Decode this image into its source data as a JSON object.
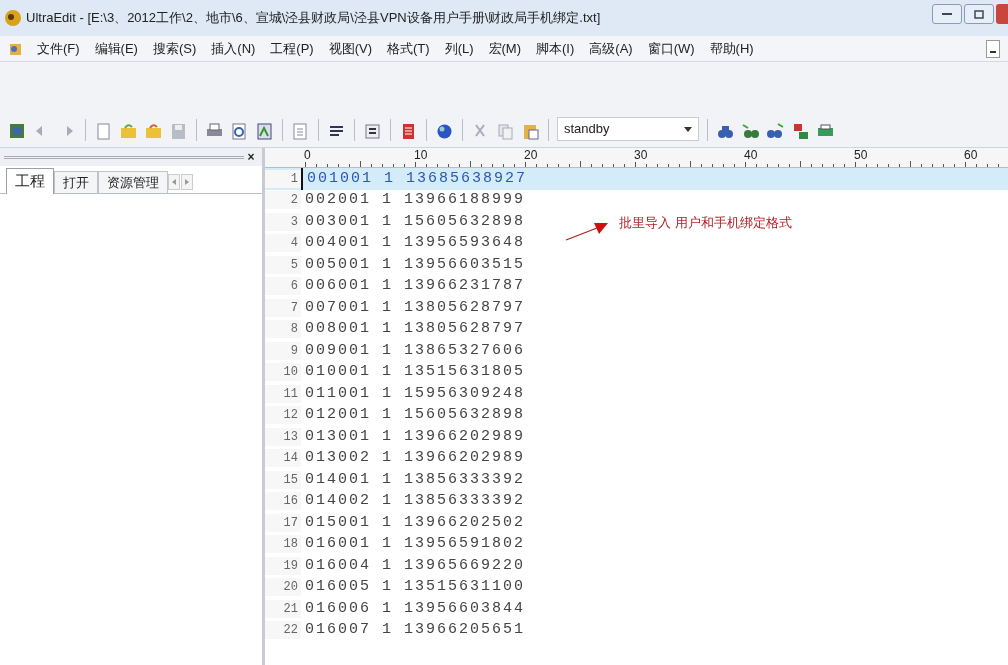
{
  "window": {
    "title": "UltraEdit - [E:\\3、2012工作\\2、地市\\6、宣城\\泾县财政局\\泾县VPN设备用户手册\\财政局手机绑定.txt]"
  },
  "menu": [
    "文件(F)",
    "编辑(E)",
    "搜索(S)",
    "插入(N)",
    "工程(P)",
    "视图(V)",
    "格式(T)",
    "列(L)",
    "宏(M)",
    "脚本(I)",
    "高级(A)",
    "窗口(W)",
    "帮助(H)"
  ],
  "toolbar": {
    "dropdown_value": "standby"
  },
  "side_panel": {
    "close_glyph": "×",
    "tabs": [
      {
        "label": "工程",
        "selected": true
      },
      {
        "label": "打开",
        "selected": false
      },
      {
        "label": "资源管理",
        "selected": false
      }
    ]
  },
  "editor": {
    "ruler_labels": [
      "0",
      "10",
      "20",
      "30",
      "40",
      "50",
      "60"
    ],
    "lines": [
      {
        "number": "1",
        "text": "001001 1 13685638927",
        "selected": true
      },
      {
        "number": "2",
        "text": "002001 1 13966188999",
        "selected": false
      },
      {
        "number": "3",
        "text": "003001 1 15605632898",
        "selected": false
      },
      {
        "number": "4",
        "text": "004001 1 13956593648",
        "selected": false
      },
      {
        "number": "5",
        "text": "005001 1 13956603515",
        "selected": false
      },
      {
        "number": "6",
        "text": "006001 1 13966231787",
        "selected": false
      },
      {
        "number": "7",
        "text": "007001 1 13805628797",
        "selected": false
      },
      {
        "number": "8",
        "text": "008001 1 13805628797",
        "selected": false
      },
      {
        "number": "9",
        "text": "009001 1 13865327606",
        "selected": false
      },
      {
        "number": "10",
        "text": "010001 1 13515631805",
        "selected": false
      },
      {
        "number": "11",
        "text": "011001 1 15956309248",
        "selected": false
      },
      {
        "number": "12",
        "text": "012001 1 15605632898",
        "selected": false
      },
      {
        "number": "13",
        "text": "013001 1 13966202989",
        "selected": false
      },
      {
        "number": "14",
        "text": "013002 1 13966202989",
        "selected": false
      },
      {
        "number": "15",
        "text": "014001 1 13856333392",
        "selected": false
      },
      {
        "number": "16",
        "text": "014002 1 13856333392",
        "selected": false
      },
      {
        "number": "17",
        "text": "015001 1 13966202502",
        "selected": false
      },
      {
        "number": "18",
        "text": "016001 1 13956591802",
        "selected": false
      },
      {
        "number": "19",
        "text": "016004 1 13965669220",
        "selected": false
      },
      {
        "number": "20",
        "text": "016005 1 13515631100",
        "selected": false
      },
      {
        "number": "21",
        "text": "016006 1 13956603844",
        "selected": false
      },
      {
        "number": "22",
        "text": "016007 1 13966205651",
        "selected": false
      }
    ],
    "annotation": {
      "text": "批里导入 用户和手机绑定格式"
    }
  }
}
